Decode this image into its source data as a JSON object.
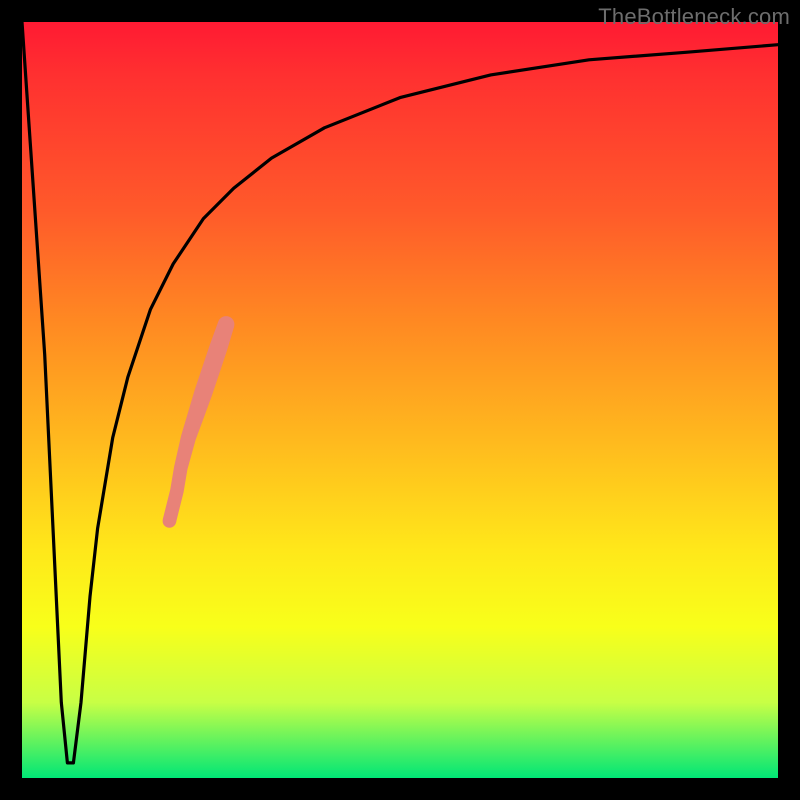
{
  "watermark": "TheBottleneck.com",
  "chart_data": {
    "type": "line",
    "title": "",
    "xlabel": "",
    "ylabel": "",
    "xlim": [
      0,
      100
    ],
    "ylim": [
      0,
      100
    ],
    "grid": false,
    "background_gradient": {
      "direction": "top-to-bottom",
      "stops": [
        {
          "pos": 0.0,
          "color": "#ff1a33"
        },
        {
          "pos": 0.25,
          "color": "#ff5a2a"
        },
        {
          "pos": 0.55,
          "color": "#ffb81e"
        },
        {
          "pos": 0.8,
          "color": "#f8ff1a"
        },
        {
          "pos": 1.0,
          "color": "#00e676"
        }
      ]
    },
    "series": [
      {
        "name": "bottleneck-curve",
        "x": [
          0,
          3,
          5.2,
          6.0,
          6.8,
          7.8,
          9.0,
          10,
          12,
          14,
          17,
          20,
          24,
          28,
          33,
          40,
          50,
          62,
          75,
          88,
          100
        ],
        "y": [
          100,
          56,
          10,
          2,
          2,
          10,
          24,
          33,
          45,
          53,
          62,
          68,
          74,
          78,
          82,
          86,
          90,
          93,
          95,
          96,
          97
        ]
      }
    ],
    "highlights": {
      "name": "salmon-points",
      "description": "cluster of salmon-colored markers along the rising limb",
      "points": [
        {
          "x": 19.5,
          "y": 34.0,
          "r": 0.9
        },
        {
          "x": 20.5,
          "y": 38.0,
          "r": 0.9
        },
        {
          "x": 21.0,
          "y": 41.0,
          "r": 0.9
        },
        {
          "x": 22.0,
          "y": 45.0,
          "r": 1.0
        },
        {
          "x": 23.0,
          "y": 48.0,
          "r": 1.1
        },
        {
          "x": 24.0,
          "y": 51.0,
          "r": 1.2
        },
        {
          "x": 25.0,
          "y": 54.0,
          "r": 1.2
        },
        {
          "x": 26.0,
          "y": 57.0,
          "r": 1.2
        },
        {
          "x": 27.0,
          "y": 60.0,
          "r": 1.1
        }
      ]
    }
  }
}
